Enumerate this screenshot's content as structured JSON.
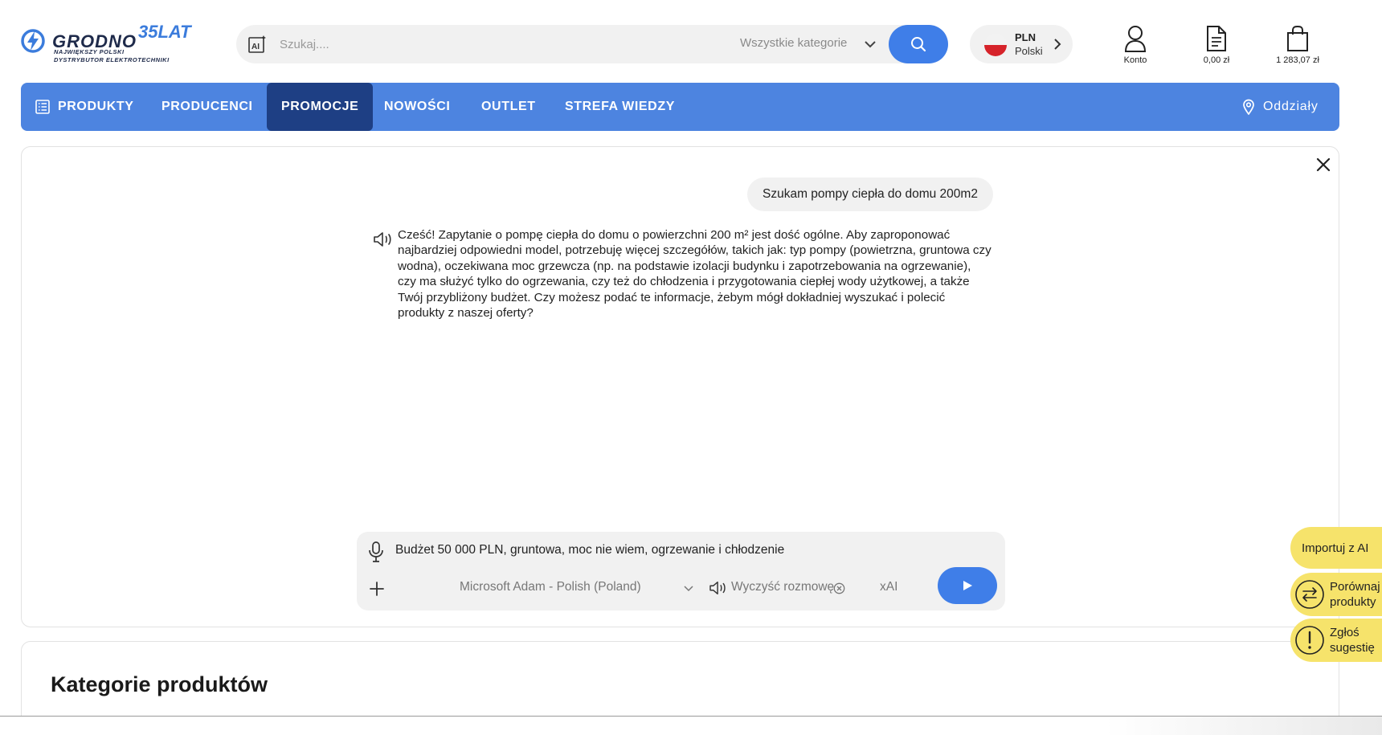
{
  "header": {
    "logo": {
      "wordmark": "GRODNO",
      "anniversary": "35LAT",
      "tagline_1": "NAJWIĘKSZY POLSKI",
      "tagline_2": "DYSTRYBUTOR ELEKTROTECHNIKI"
    },
    "search": {
      "placeholder": "Szukaj....",
      "value": "",
      "category": "Wszystkie kategorie"
    },
    "currency": {
      "code": "PLN",
      "language": "Polski"
    },
    "account_label": "Konto",
    "quote_total": "0,00 zł",
    "cart_total": "1 283,07 zł"
  },
  "nav": {
    "items": [
      {
        "label": "PRODUKTY"
      },
      {
        "label": "PRODUCENCI"
      },
      {
        "label": "PROMOCJE",
        "active": true
      },
      {
        "label": "NOWOŚCI"
      },
      {
        "label": "OUTLET"
      },
      {
        "label": "STREFA WIEDZY"
      }
    ],
    "branches_label": "Oddziały"
  },
  "chat": {
    "user_message": "Szukam pompy ciepła do domu 200m2",
    "ai_message": "Cześć! Zapytanie o pompę ciepła do domu o powierzchni 200 m² jest dość ogólne. Aby zaproponować najbardziej odpowiedni model, potrzebuję więcej szczegółów, takich jak: typ pompy (powietrzna, gruntowa czy wodna), oczekiwana moc grzewcza (np. na podstawie izolacji budynku i zapotrzebowania na ogrzewanie), czy ma służyć tylko do ogrzewania, czy też do chłodzenia i przygotowania ciepłej wody użytkowej, a także Twój przybliżony budżet. Czy możesz podać te informacje, żebym mógł dokładniej wyszukać i polecić produkty z naszej oferty?",
    "composer": {
      "input_value": "Budżet 50 000 PLN, gruntowa, moc nie wiem, ogrzewanie i chłodzenie",
      "voice": "Microsoft Adam - Polish (Poland)",
      "clear_label": "Wyczyść rozmowę",
      "model": "xAI"
    }
  },
  "categories_heading": "Kategorie produktów",
  "side_buttons": {
    "import_ai": "Importuj z AI",
    "compare_1": "Porównaj",
    "compare_2": "produkty",
    "report_1": "Zgłoś",
    "report_2": "sugestię"
  },
  "colors": {
    "accent_blue": "#4d84e0",
    "active_nav": "#1e3f84",
    "button_blue": "#3f7ee8",
    "side_yellow": "#f6e36b"
  }
}
